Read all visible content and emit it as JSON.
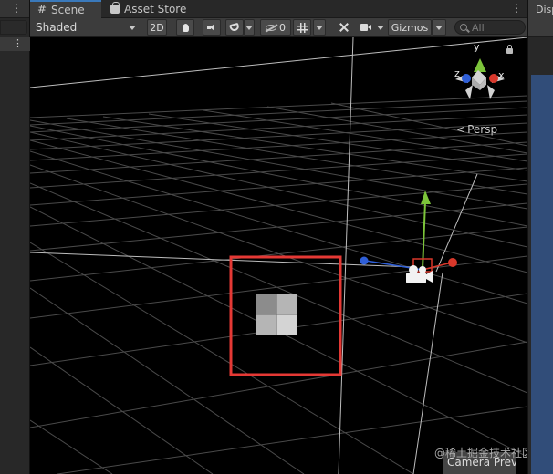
{
  "tabs": {
    "scene": "Scene",
    "asset_store": "Asset Store"
  },
  "toolbar": {
    "draw_mode": "Shaded",
    "mode_2d": "2D",
    "hidden_count": "0",
    "gizmos": "Gizmos",
    "search_placeholder": "All"
  },
  "right_panel": {
    "tab_label": "Disp"
  },
  "viewport": {
    "projection": "Persp",
    "axes": {
      "x": "x",
      "y": "y",
      "z": "z"
    },
    "camera_preview_label": "Camera Previe",
    "watermark": "@稀土掘金技术社区"
  },
  "colors": {
    "axis_x": "#d9382b",
    "axis_y": "#7cc43a",
    "axis_z": "#2f5fd8",
    "highlight": "#e53935",
    "tab_accent": "#3a79bb"
  }
}
